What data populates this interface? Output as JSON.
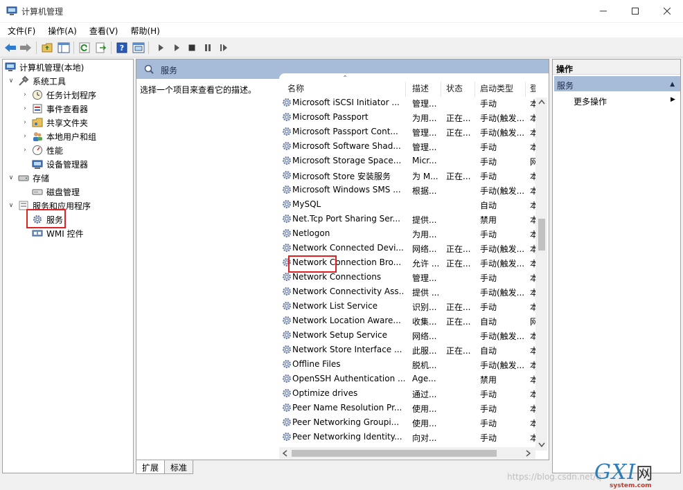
{
  "window": {
    "title": "计算机管理"
  },
  "menu": [
    "文件(F)",
    "操作(A)",
    "查看(V)",
    "帮助(H)"
  ],
  "tree": {
    "root": "计算机管理(本地)",
    "system_tools": "系统工具",
    "task_scheduler": "任务计划程序",
    "event_viewer": "事件查看器",
    "shared_folders": "共享文件夹",
    "local_users": "本地用户和组",
    "performance": "性能",
    "device_manager": "设备管理器",
    "storage": "存储",
    "disk_management": "磁盘管理",
    "services_apps": "服务和应用程序",
    "services": "服务",
    "wmi": "WMI 控件"
  },
  "center": {
    "header_title": "服务",
    "description": "选择一个项目来查看它的描述。",
    "columns": [
      "名称",
      "描述",
      "状态",
      "启动类型",
      "登"
    ],
    "rows": [
      {
        "name": "Microsoft iSCSI Initiator ...",
        "desc": "管理...",
        "status": "",
        "startup": "手动",
        "logon": "本"
      },
      {
        "name": "Microsoft Passport",
        "desc": "为用...",
        "status": "正在...",
        "startup": "手动(触发...",
        "logon": "本"
      },
      {
        "name": "Microsoft Passport Cont...",
        "desc": "管理...",
        "status": "正在...",
        "startup": "手动(触发...",
        "logon": "本"
      },
      {
        "name": "Microsoft Software Shad...",
        "desc": "管理...",
        "status": "",
        "startup": "手动",
        "logon": "本"
      },
      {
        "name": "Microsoft Storage Space...",
        "desc": "Micr...",
        "status": "",
        "startup": "手动",
        "logon": "网"
      },
      {
        "name": "Microsoft Store 安装服务",
        "desc": "为 M...",
        "status": "正在...",
        "startup": "手动",
        "logon": "本"
      },
      {
        "name": "Microsoft Windows SMS ...",
        "desc": "根据...",
        "status": "",
        "startup": "手动(触发...",
        "logon": "本"
      },
      {
        "name": "MySQL",
        "desc": "",
        "status": "",
        "startup": "自动",
        "logon": "本"
      },
      {
        "name": "Net.Tcp Port Sharing Ser...",
        "desc": "提供...",
        "status": "",
        "startup": "禁用",
        "logon": "本"
      },
      {
        "name": "Netlogon",
        "desc": "为用...",
        "status": "",
        "startup": "手动",
        "logon": "本"
      },
      {
        "name": "Network Connected Devi...",
        "desc": "网络...",
        "status": "正在...",
        "startup": "手动(触发...",
        "logon": "本"
      },
      {
        "name": "Network Connection Bro...",
        "desc": "允许 ...",
        "status": "正在...",
        "startup": "手动(触发...",
        "logon": "本"
      },
      {
        "name": "Network Connections",
        "desc": "管理...",
        "status": "",
        "startup": "手动",
        "logon": "本"
      },
      {
        "name": "Network Connectivity Ass...",
        "desc": "提供 ...",
        "status": "",
        "startup": "手动(触发...",
        "logon": "本"
      },
      {
        "name": "Network List Service",
        "desc": "识别...",
        "status": "正在...",
        "startup": "手动",
        "logon": "本"
      },
      {
        "name": "Network Location Aware...",
        "desc": "收集...",
        "status": "正在...",
        "startup": "自动",
        "logon": "网"
      },
      {
        "name": "Network Setup Service",
        "desc": "网络...",
        "status": "",
        "startup": "手动(触发...",
        "logon": "本"
      },
      {
        "name": "Network Store Interface ...",
        "desc": "此服...",
        "status": "正在...",
        "startup": "自动",
        "logon": "本"
      },
      {
        "name": "Offline Files",
        "desc": "脱机...",
        "status": "",
        "startup": "手动(触发...",
        "logon": "本"
      },
      {
        "name": "OpenSSH Authentication ...",
        "desc": "Age...",
        "status": "",
        "startup": "禁用",
        "logon": "本"
      },
      {
        "name": "Optimize drives",
        "desc": "通过...",
        "status": "",
        "startup": "手动",
        "logon": "本"
      },
      {
        "name": "Peer Name Resolution Pr...",
        "desc": "使用...",
        "status": "",
        "startup": "手动",
        "logon": "本"
      },
      {
        "name": "Peer Networking Groupi...",
        "desc": "使用...",
        "status": "",
        "startup": "手动",
        "logon": "本"
      },
      {
        "name": "Peer Networking Identity...",
        "desc": "向对...",
        "status": "",
        "startup": "手动",
        "logon": "本"
      }
    ]
  },
  "tabs": [
    "扩展",
    "标准"
  ],
  "actions": {
    "header": "操作",
    "section": "服务",
    "more": "更多操作"
  },
  "watermark": "https://blog.csdn.net/q",
  "logo": {
    "main": "GXI",
    "cn": "网",
    "sub": "system.com"
  },
  "colors": {
    "header_blue": "#a6bcd8",
    "highlight_red": "#e02020"
  }
}
